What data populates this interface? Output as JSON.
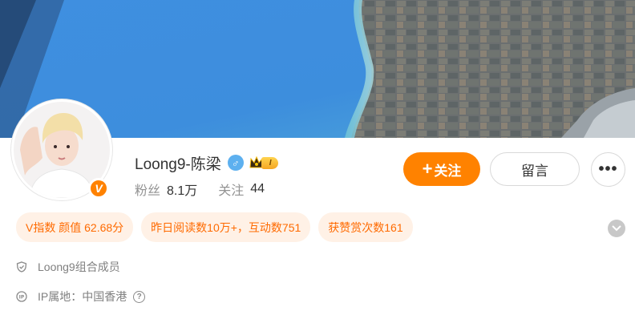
{
  "profile": {
    "name": "Loong9-陈梁",
    "gender_symbol": "♂",
    "level": "I",
    "verified_mark": "V",
    "stats": [
      {
        "label": "粉丝",
        "value": "8.1万"
      },
      {
        "label": "关注",
        "value": "44"
      }
    ]
  },
  "actions": {
    "follow_plus": "+",
    "follow_label": "关注",
    "message_label": "留言",
    "more_label": "•••"
  },
  "tags": [
    "V指数 颜值 62.68分",
    "昨日阅读数10万+，互动数751",
    "获赞赏次数161"
  ],
  "info": {
    "description": "Loong9组合成员",
    "ip_location": "IP属地：中国香港",
    "help_symbol": "?"
  },
  "icons": {
    "gender": "male-icon",
    "level": "crown-icon",
    "expand": "chevron-down-icon",
    "description": "shield-icon",
    "ip": "ip-icon",
    "help": "question-icon"
  },
  "colors": {
    "accent": "#ff8200",
    "tag_bg": "#fff1e6",
    "tag_text": "#ff6a00",
    "gender": "#5db0ef"
  }
}
